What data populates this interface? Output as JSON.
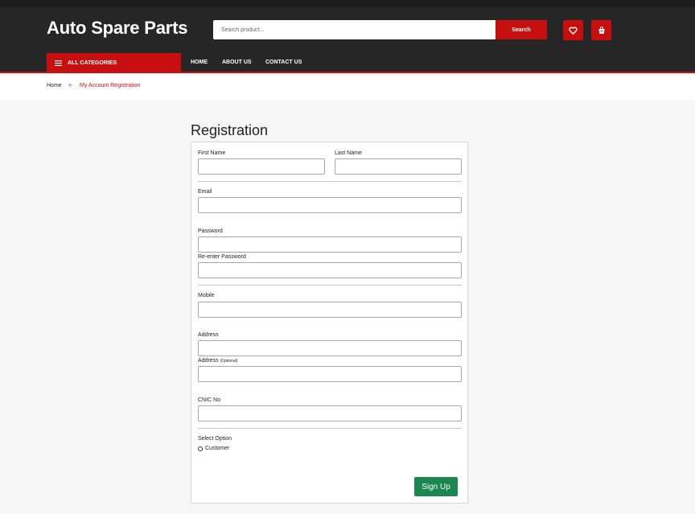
{
  "header": {
    "logo": "Auto Spare Parts",
    "search_placeholder": "Search product...",
    "search_button": "Search",
    "icons": [
      "heart-icon",
      "cart-icon"
    ]
  },
  "nav": {
    "categories_label": "ALL CATEGORIES",
    "links": [
      "HOME",
      "ABOUT US",
      "CONTACT US"
    ]
  },
  "breadcrumb": {
    "home": "Home",
    "separator": ">",
    "current": "My Account Registration"
  },
  "form": {
    "title": "Registration",
    "first_name_label": "First Name",
    "last_name_label": "Last Name",
    "email_label": "Email",
    "password_label": "Password",
    "reenter_password_label": "Re-enter Password",
    "mobile_label": "Mobile",
    "address_label": "Address",
    "address2_label": "Address",
    "address2_optional": "(Optional)",
    "cnic_label": "CNIC No",
    "select_option_label": "Select Option",
    "customer_option": "Customer",
    "signup_button": "Sign Up"
  },
  "colors": {
    "accent_red": "#c80f0f",
    "header_bg": "#262626",
    "signup_green": "#1a8751"
  }
}
